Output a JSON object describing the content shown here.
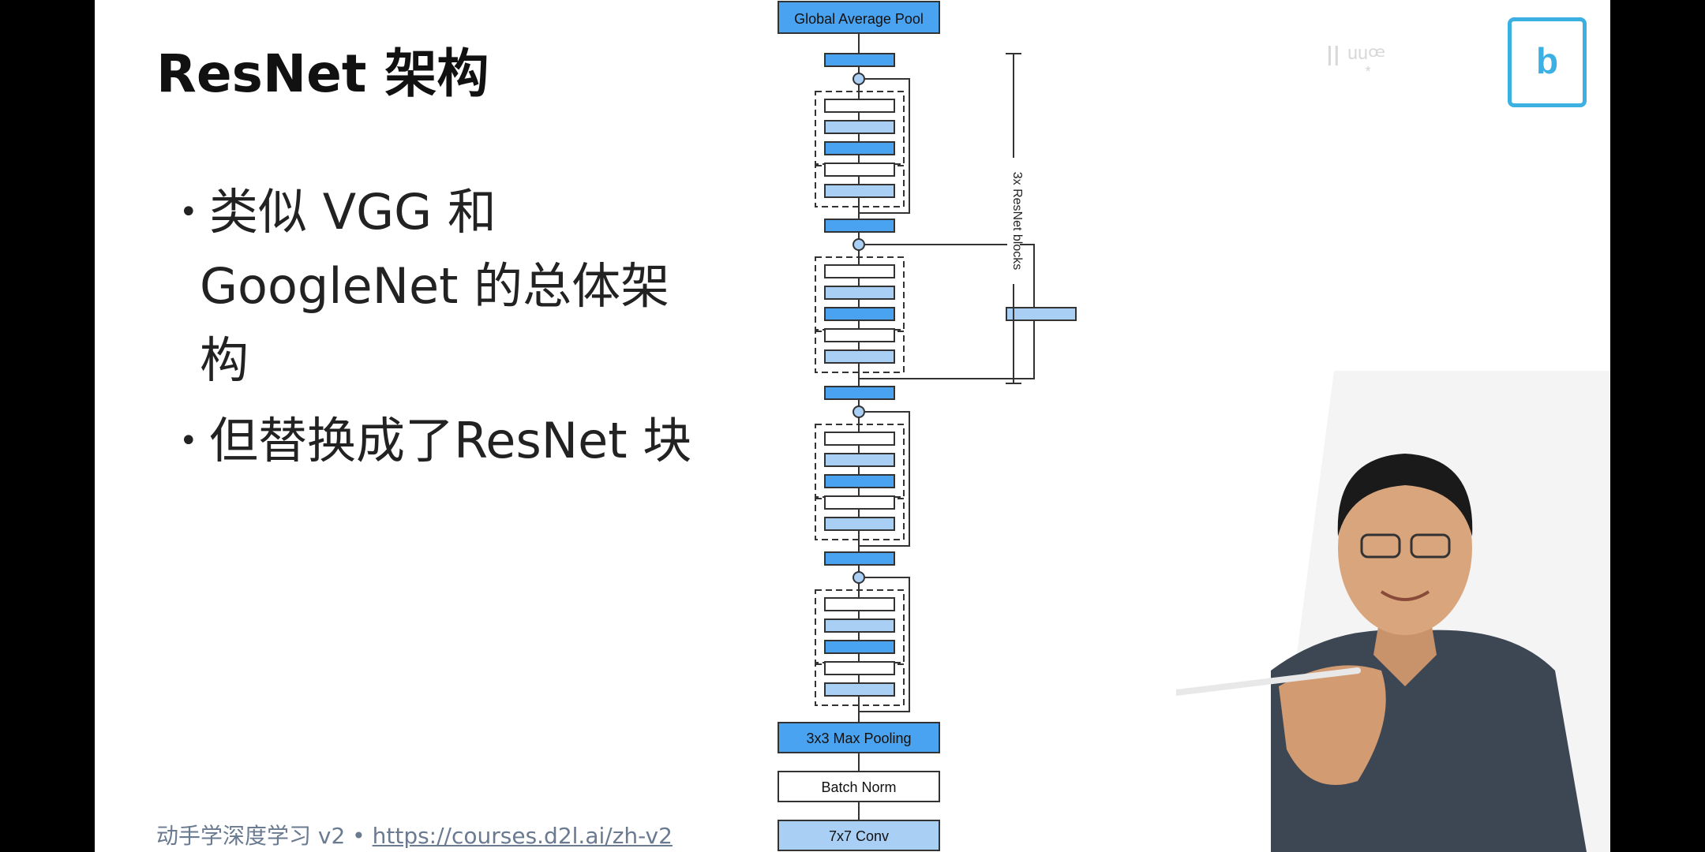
{
  "slide": {
    "title": "ResNet 架构",
    "bullets": [
      {
        "lines": [
          "类似 VGG 和",
          "GoogleNet 的总体架",
          "构"
        ]
      },
      {
        "lines": [
          "但替换成了ResNet 块"
        ]
      }
    ],
    "footer": {
      "course": "动手学深度学习 v2 • ",
      "url": "https://courses.d2l.ai/zh-v2"
    }
  },
  "diagram": {
    "top_label": "Global Average Pool",
    "bottom_labels": [
      "3x3 Max Pooling",
      "Batch Norm",
      "7x7 Conv"
    ],
    "bracket_label": "3x ResNet blocks"
  },
  "watermark": {
    "glyph": "b"
  },
  "colors": {
    "dark_blue": "#4aa3f0",
    "light_blue": "#a9cff5",
    "outline": "#333333",
    "footer_text": "#6a7a90",
    "watermark": "#29a8e0"
  }
}
